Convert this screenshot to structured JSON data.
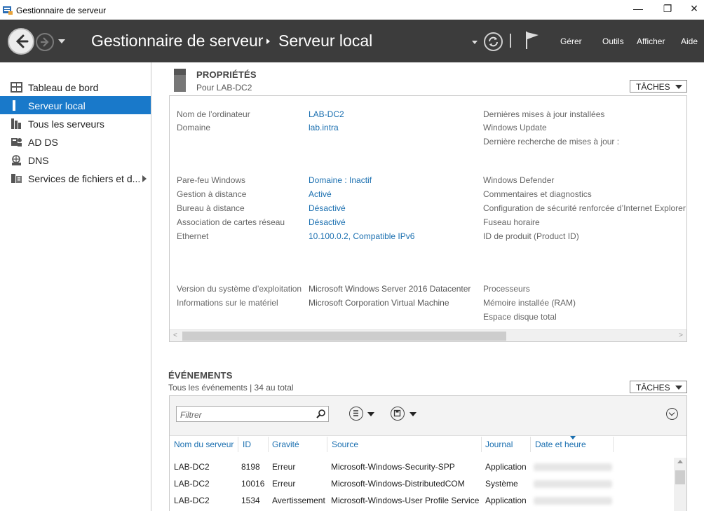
{
  "window": {
    "title": "Gestionnaire de serveur",
    "controls": {
      "minimize": "—",
      "restore": "❐",
      "close": "✕"
    }
  },
  "header": {
    "app": "Gestionnaire de serveur",
    "page": "Serveur local",
    "menu": [
      "Gérer",
      "Outils",
      "Afficher",
      "Aide"
    ]
  },
  "sidebar": {
    "items": [
      {
        "label": "Tableau de bord",
        "icon": "dashboard-icon"
      },
      {
        "label": "Serveur local",
        "icon": "local-server-icon",
        "active": true
      },
      {
        "label": "Tous les serveurs",
        "icon": "all-servers-icon"
      },
      {
        "label": "AD DS",
        "icon": "ad-ds-icon"
      },
      {
        "label": "DNS",
        "icon": "dns-icon"
      },
      {
        "label": "Services de fichiers et d...",
        "icon": "file-services-icon"
      }
    ]
  },
  "properties": {
    "title": "PROPRIÉTÉS",
    "subtitle": "Pour LAB-DC2",
    "tasks": "TÂCHES",
    "rows_col1": [
      {
        "label": "Nom de l’ordinateur",
        "value": "LAB-DC2"
      },
      {
        "label": "Domaine",
        "value": "lab.intra"
      },
      {
        "label": "Pare-feu Windows",
        "value": "Domaine : Inactif"
      },
      {
        "label": "Gestion à distance",
        "value": "Activé"
      },
      {
        "label": "Bureau à distance",
        "value": "Désactivé"
      },
      {
        "label": "Association de cartes réseau",
        "value": "Désactivé"
      },
      {
        "label": "Ethernet",
        "value": "10.100.0.2, Compatible IPv6"
      },
      {
        "label": "Version du système d’exploitation",
        "value": "Microsoft Windows Server 2016 Datacenter"
      },
      {
        "label": "Informations sur le matériel",
        "value": "Microsoft Corporation Virtual Machine"
      }
    ],
    "rows_col2": [
      "Dernières mises à jour installées",
      "Windows Update",
      "Dernière recherche de mises à jour :",
      "Windows Defender",
      "Commentaires et diagnostics",
      "Configuration de sécurité renforcée d’Internet Explorer",
      "Fuseau horaire",
      "ID de produit (Product ID)",
      "Processeurs",
      "Mémoire installée (RAM)",
      "Espace disque total"
    ]
  },
  "events": {
    "title": "ÉVÉNEMENTS",
    "subtitle": "Tous les événements | 34 au total",
    "tasks": "TÂCHES",
    "filter_placeholder": "Filtrer",
    "columns": [
      "Nom du serveur",
      "ID",
      "Gravité",
      "Source",
      "Journal",
      "Date et heure"
    ],
    "rows": [
      [
        "LAB-DC2",
        "8198",
        "Erreur",
        "Microsoft-Windows-Security-SPP",
        "Application"
      ],
      [
        "LAB-DC2",
        "10016",
        "Erreur",
        "Microsoft-Windows-DistributedCOM",
        "Système"
      ],
      [
        "LAB-DC2",
        "1534",
        "Avertissement",
        "Microsoft-Windows-User Profile Service",
        "Application"
      ]
    ]
  },
  "colors": {
    "header_bg": "#3c3c3c",
    "accent": "#1979ca",
    "link": "#1a6fb0"
  }
}
